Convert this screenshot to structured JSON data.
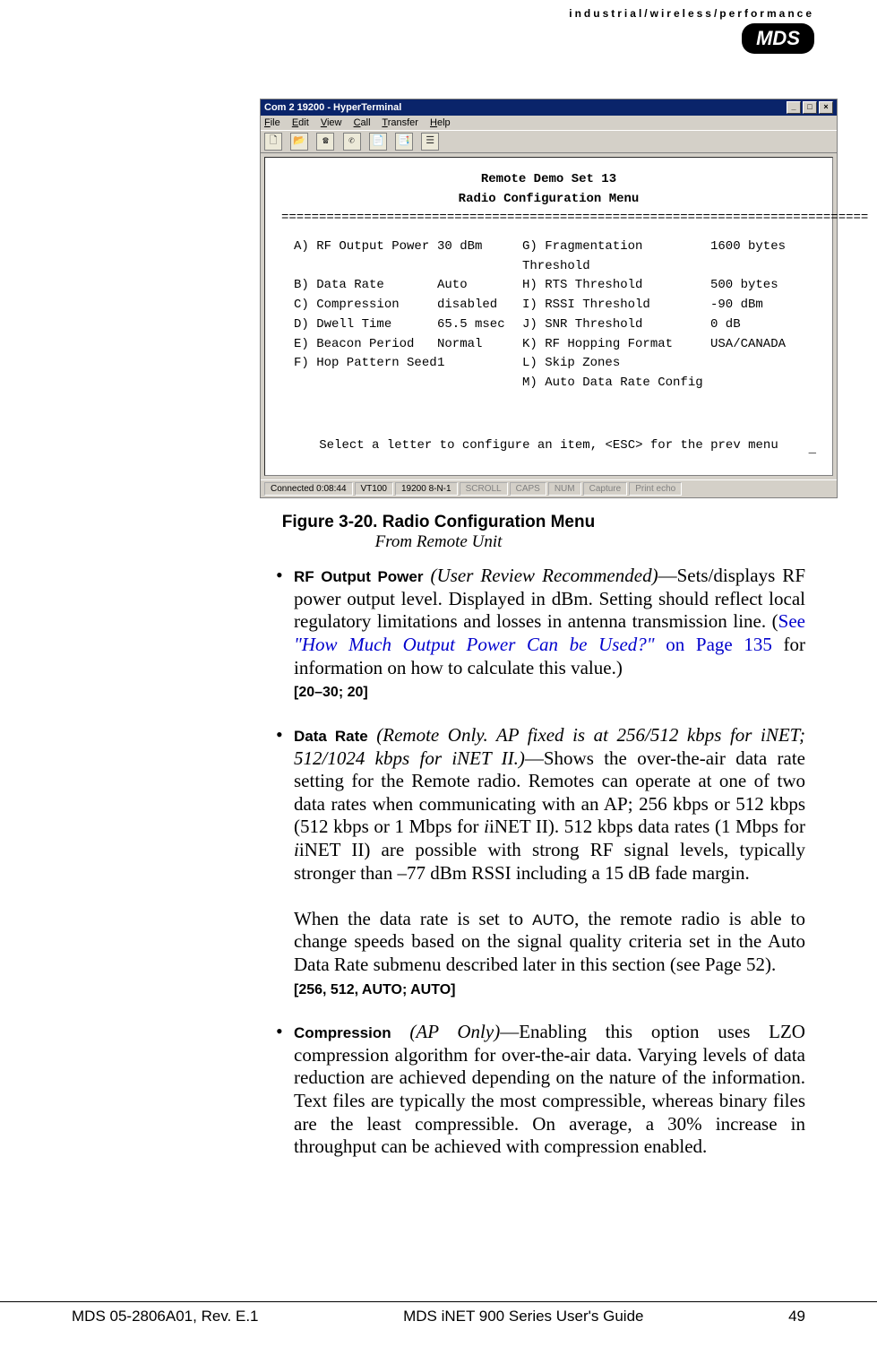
{
  "header": {
    "tagline": "industrial/wireless/performance",
    "logo": "MDS"
  },
  "terminal": {
    "title": "Com 2 19200 - HyperTerminal",
    "menus": [
      "File",
      "Edit",
      "View",
      "Call",
      "Transfer",
      "Help"
    ],
    "screen_title_1": "Remote Demo Set 13",
    "screen_title_2": "Radio Configuration Menu",
    "rows_left": [
      {
        "k": "A) RF Output Power",
        "v": "30 dBm"
      },
      {
        "k": "B) Data Rate",
        "v": "Auto"
      },
      {
        "k": "C) Compression",
        "v": "disabled"
      },
      {
        "k": "D) Dwell Time",
        "v": "65.5 msec"
      },
      {
        "k": "E) Beacon Period",
        "v": "Normal"
      },
      {
        "k": "F) Hop Pattern Seed",
        "v": "1"
      }
    ],
    "rows_right": [
      {
        "k": "G) Fragmentation Threshold",
        "v": "1600 bytes"
      },
      {
        "k": "H) RTS Threshold",
        "v": "500 bytes"
      },
      {
        "k": "I) RSSI Threshold",
        "v": "-90 dBm"
      },
      {
        "k": "J) SNR Threshold",
        "v": "0 dB"
      },
      {
        "k": "K) RF Hopping Format",
        "v": "USA/CANADA"
      },
      {
        "k": "L) Skip Zones",
        "v": ""
      },
      {
        "k": "M) Auto Data Rate Config",
        "v": ""
      }
    ],
    "prompt": "Select a letter to configure an item, <ESC> for the prev menu",
    "status": {
      "connected": "Connected 0:08:44",
      "emulation": "VT100",
      "settings": "19200 8-N-1",
      "flags": [
        "SCROLL",
        "CAPS",
        "NUM",
        "Capture",
        "Print echo"
      ]
    }
  },
  "figure": {
    "caption": "Figure 3-20. Radio Configuration Menu",
    "sub": "From Remote Unit"
  },
  "items": {
    "rf": {
      "term": "RF Output Power",
      "qual": " (User Review Recommended)",
      "body1": "—Sets/displays RF power output level. Displayed in dBm. Setting should reflect local regulatory limitations and losses in antenna transmission line. (",
      "link1": "See ",
      "link_quote": "\"How Much Output Power Can be Used?\"",
      "link2": " on Page 135",
      "body2": " for information on how to calculate this value.)",
      "range": "[20–30; 20]"
    },
    "dr": {
      "term": "Data Rate",
      "qual": " (Remote Only. AP fixed is at 256/512 kbps for iNET; 512/1024 kbps for iNET II.)",
      "body1": "—Shows the over-the-air data rate setting for the Remote radio. Remotes can operate at one of two data rates when communicating with an AP; 256 kbps or 512 kbps (512 kbps or 1 Mbps for ",
      "inet_ii_1": "iNET II). 512 kbps data rates (1 Mbps for ",
      "inet_ii_2": "iNET II) are possible with strong RF signal levels, typically stronger than –77 dBm RSSI including a 15 dB fade margin.",
      "para2a": "When the data rate is set to ",
      "auto": "AUTO",
      "para2b": ", the remote radio is able to change speeds based on the signal quality criteria set in the Auto Data Rate submenu described later in this section (see Page 52).",
      "range": "[256, 512, AUTO; AUTO]"
    },
    "comp": {
      "term": "Compression",
      "qual": " (AP Only)",
      "body": "—Enabling this option uses LZO compression algorithm for over-the-air data. Varying levels of data reduction are achieved depending on the nature of the information. Text files are typically the most compressible, whereas binary files are the least compressible. On average, a 30% increase in throughput can be achieved with compression enabled."
    }
  },
  "footer": {
    "left": "MDS 05-2806A01, Rev. E.1",
    "center": "MDS iNET 900 Series User's Guide",
    "right": "49"
  },
  "chart_data": {
    "type": "table",
    "title": "Radio Configuration Menu — Remote Demo Set 13",
    "rows": [
      {
        "key": "A",
        "label": "RF Output Power",
        "value": "30 dBm"
      },
      {
        "key": "B",
        "label": "Data Rate",
        "value": "Auto"
      },
      {
        "key": "C",
        "label": "Compression",
        "value": "disabled"
      },
      {
        "key": "D",
        "label": "Dwell Time",
        "value": "65.5 msec"
      },
      {
        "key": "E",
        "label": "Beacon Period",
        "value": "Normal"
      },
      {
        "key": "F",
        "label": "Hop Pattern Seed",
        "value": "1"
      },
      {
        "key": "G",
        "label": "Fragmentation Threshold",
        "value": "1600 bytes"
      },
      {
        "key": "H",
        "label": "RTS Threshold",
        "value": "500 bytes"
      },
      {
        "key": "I",
        "label": "RSSI Threshold",
        "value": "-90 dBm"
      },
      {
        "key": "J",
        "label": "SNR Threshold",
        "value": "0 dB"
      },
      {
        "key": "K",
        "label": "RF Hopping Format",
        "value": "USA/CANADA"
      },
      {
        "key": "L",
        "label": "Skip Zones",
        "value": ""
      },
      {
        "key": "M",
        "label": "Auto Data Rate Config",
        "value": ""
      }
    ]
  }
}
